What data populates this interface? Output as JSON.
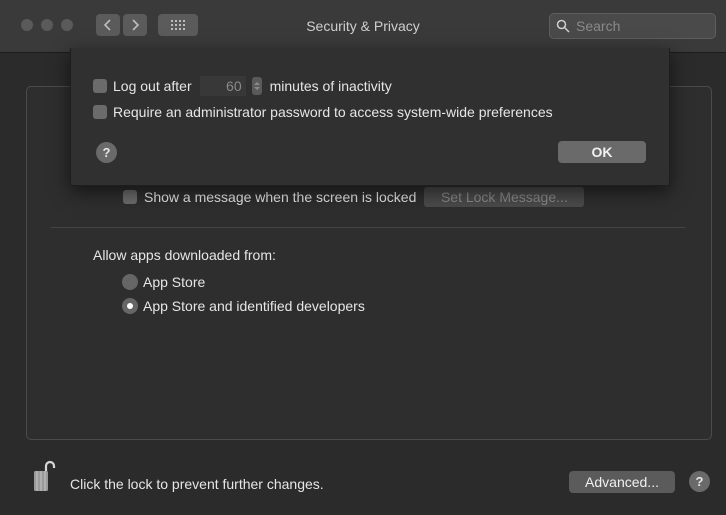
{
  "window": {
    "title": "Security & Privacy",
    "search_placeholder": "Search"
  },
  "sheet": {
    "logout_label_before": "Log out after",
    "logout_minutes": "60",
    "logout_label_after": "minutes of inactivity",
    "require_admin_label": "Require an administrator password to access system-wide preferences",
    "help_label": "?",
    "ok_label": "OK"
  },
  "general": {
    "show_message_label": "Show a message when the screen is locked",
    "set_lock_message_label": "Set Lock Message..."
  },
  "allow_apps": {
    "heading": "Allow apps downloaded from:",
    "options": [
      {
        "label": "App Store",
        "selected": false
      },
      {
        "label": "App Store and identified developers",
        "selected": true
      }
    ]
  },
  "footer": {
    "lock_text": "Click the lock to prevent further changes.",
    "advanced_label": "Advanced...",
    "help_label": "?"
  }
}
